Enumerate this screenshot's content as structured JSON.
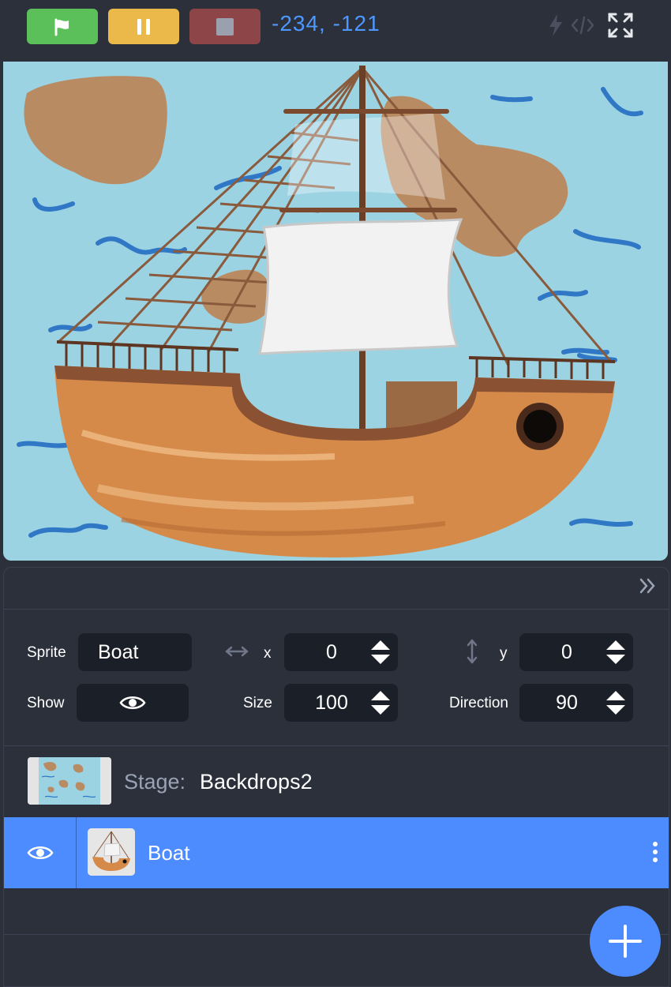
{
  "toolbar": {
    "coords": "-234,  -121",
    "colors": {
      "go": "#5cc05a",
      "pause": "#eab94a",
      "stop": "#8e4548",
      "coords": "#4d97ff"
    },
    "icons": [
      "flag-icon",
      "pause-icon",
      "stop-icon",
      "lightning-icon",
      "code-icon",
      "fullscreen-icon"
    ]
  },
  "stage": {
    "background": "#9bd3e3",
    "sprite": "ship"
  },
  "properties": {
    "sprite_label": "Sprite",
    "sprite_name": "Boat",
    "x_label": "x",
    "x_value": "0",
    "y_label": "y",
    "y_value": "0",
    "show_label": "Show",
    "size_label": "Size",
    "size_value": "100",
    "direction_label": "Direction",
    "direction_value": "90"
  },
  "stage_row": {
    "label": "Stage:",
    "name": "Backdrops2"
  },
  "sprites": [
    {
      "name": "Boat",
      "selected": true
    }
  ],
  "accent": "#4d8cff"
}
